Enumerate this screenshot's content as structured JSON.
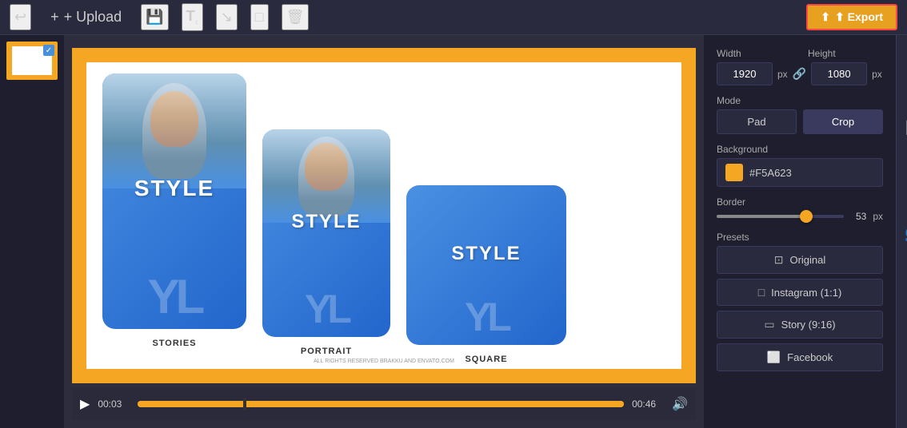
{
  "toolbar": {
    "upload_label": "+ Upload",
    "export_label": "⬆ Export"
  },
  "canvas": {
    "background_color": "#f5a623",
    "cards": [
      {
        "title": "STYLE",
        "label": "STORIES",
        "watermark": "YL",
        "size": "stories"
      },
      {
        "title": "STYLE",
        "label": "PORTRAIT",
        "watermark": "YL",
        "size": "portrait"
      },
      {
        "title": "STYLE",
        "label": "SQUARE",
        "watermark": "YL",
        "size": "square"
      }
    ],
    "copyright": "ALL RIGHTS RESERVED BRAKKU AND ENVATO.COM"
  },
  "timeline": {
    "time_start": "00:03",
    "time_end": "00:46",
    "play_icon": "▶",
    "volume_icon": "🔊"
  },
  "panel": {
    "width_label": "Width",
    "height_label": "Height",
    "width_value": "1920",
    "height_value": "1080",
    "px_label": "px",
    "mode_label": "Mode",
    "pad_label": "Pad",
    "crop_label": "Crop",
    "background_label": "Background",
    "bg_color": "#F5A623",
    "bg_hex": "#F5A623",
    "border_label": "Border",
    "border_value": "53",
    "border_px": "px",
    "presets_label": "Presets",
    "preset_original": "Original",
    "preset_instagram": "Instagram (1:1)",
    "preset_story": "Story (9:16)",
    "preset_facebook": "Facebook"
  },
  "icons": {
    "undo": "↩",
    "text": "T",
    "arrow": "↘",
    "rect": "□",
    "trash": "🗑",
    "grid": "⊞",
    "crop_icon": "⧉",
    "image": "🖼",
    "link": "🔗",
    "add_user": "👤+",
    "sliders": "≡",
    "layers": "⊟"
  }
}
